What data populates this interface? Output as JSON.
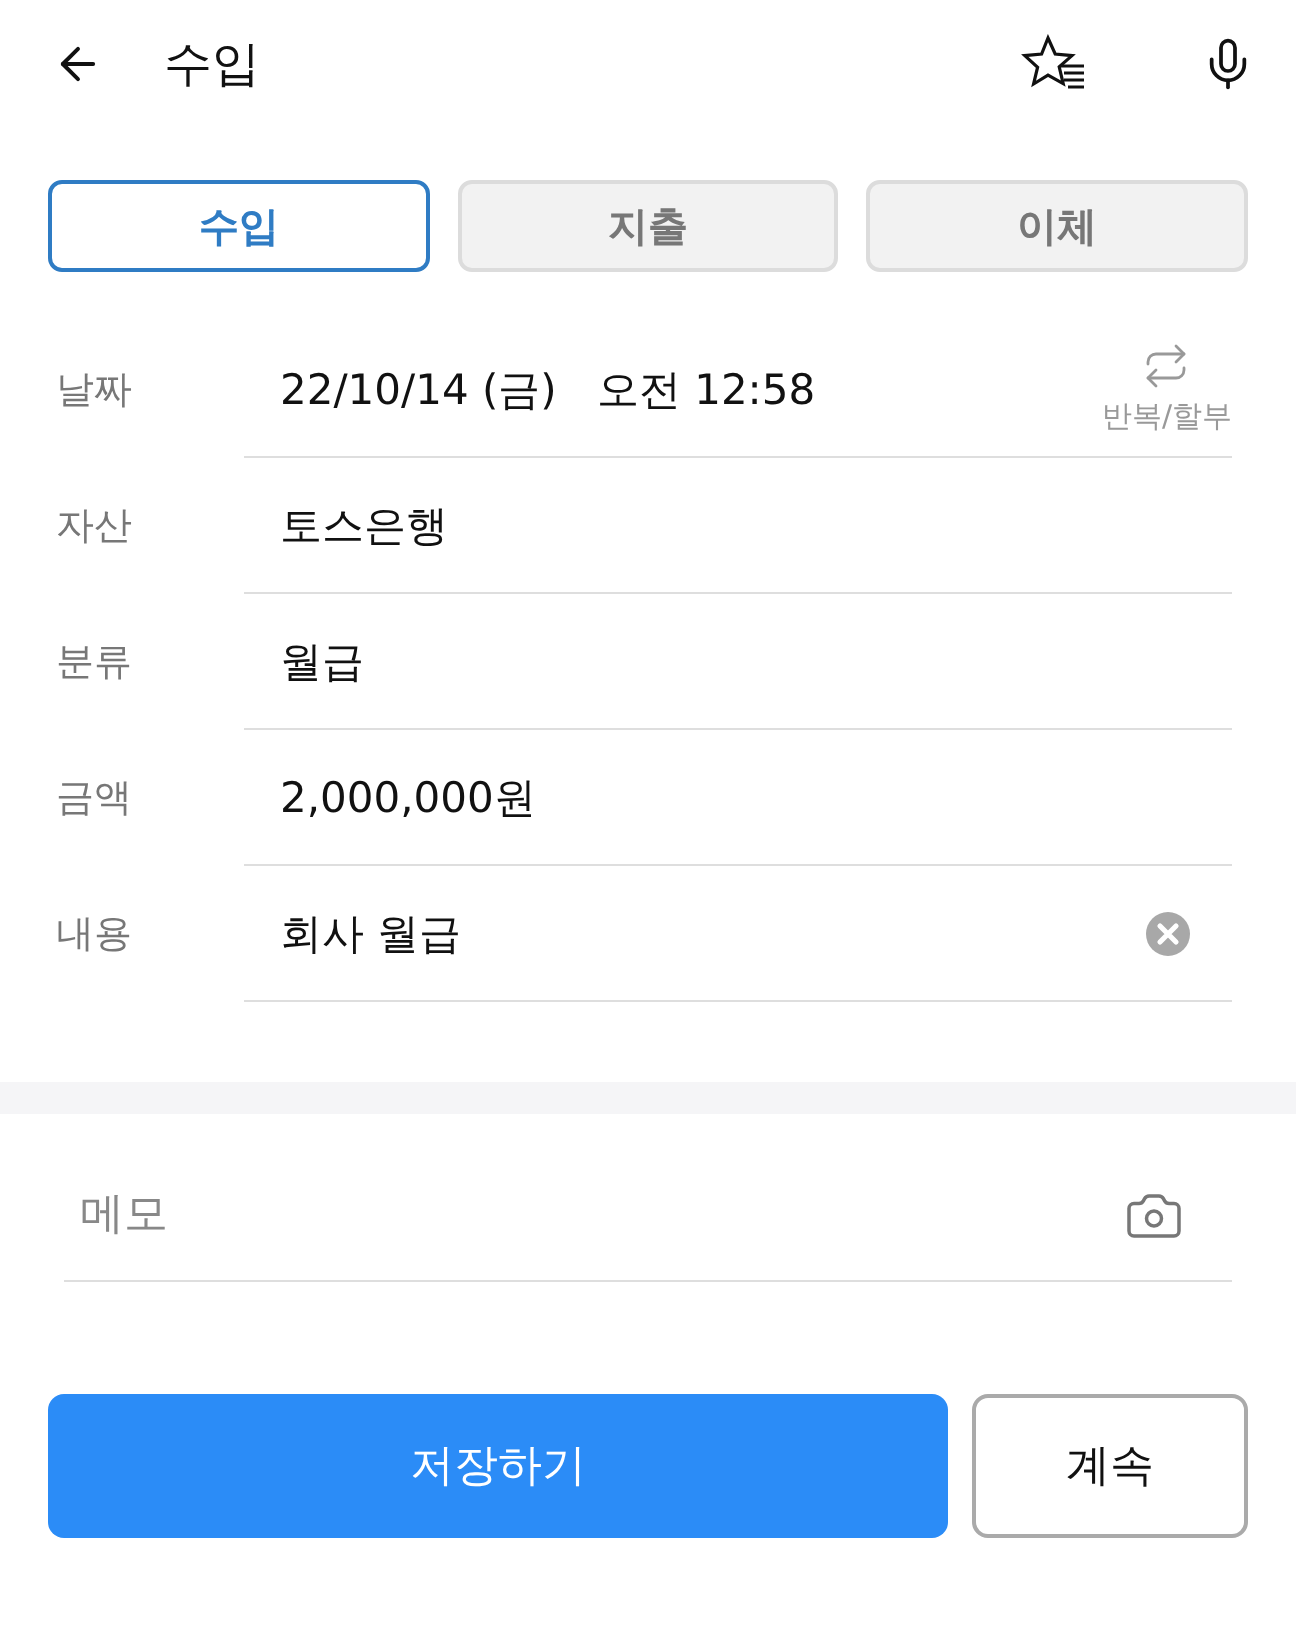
{
  "header": {
    "title": "수입"
  },
  "tabs": [
    {
      "label": "수입",
      "selected": true
    },
    {
      "label": "지출",
      "selected": false
    },
    {
      "label": "이체",
      "selected": false
    }
  ],
  "fields": [
    {
      "label": "날짜",
      "value": "22/10/14 (금)   오전 12:58",
      "action": "반복/할부",
      "clearable": false
    },
    {
      "label": "자산",
      "value": "토스은행",
      "clearable": false
    },
    {
      "label": "분류",
      "value": "월급",
      "clearable": false
    },
    {
      "label": "금액",
      "value": "2,000,000원",
      "clearable": false
    },
    {
      "label": "내용",
      "value": "회사 월급",
      "clearable": true
    }
  ],
  "memo": {
    "placeholder": "메모"
  },
  "buttons": {
    "save": "저장하기",
    "continue": "계속"
  }
}
